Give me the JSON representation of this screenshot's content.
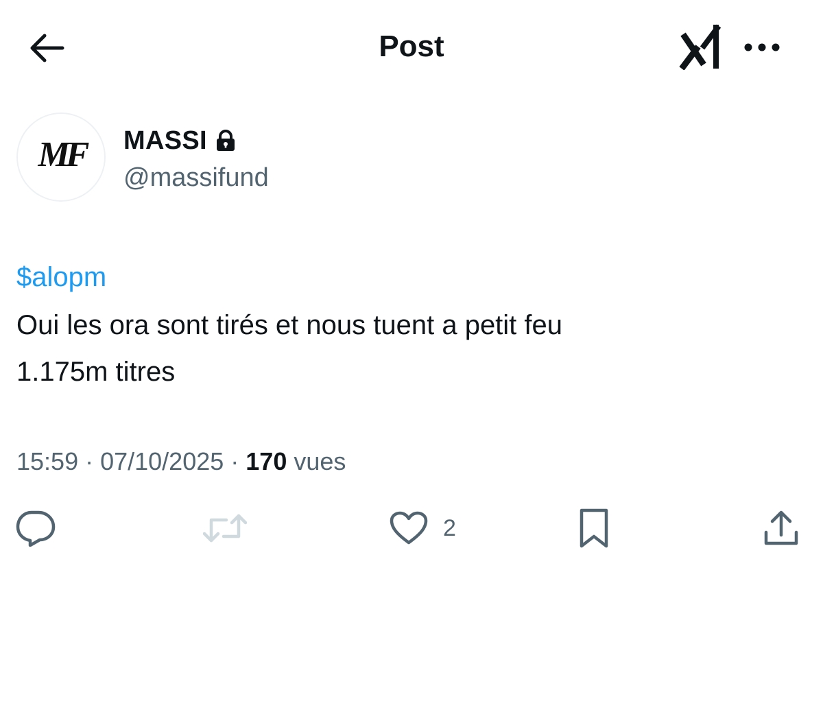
{
  "header": {
    "title": "Post",
    "back_icon": "back-arrow-icon",
    "grok_icon": "grok-icon",
    "more_icon": "more-icon"
  },
  "author": {
    "display_name": "MASSI",
    "handle": "@massifund",
    "avatar_initials": "MF",
    "protected_icon": "lock-icon"
  },
  "post": {
    "cashtag": "$alopm",
    "lines": [
      "Oui les ora sont tirés et nous tuent a petit feu",
      "1.175m titres"
    ]
  },
  "meta": {
    "time": "15:59",
    "separator": " · ",
    "date": "07/10/2025",
    "views_count": "170",
    "views_label": "vues"
  },
  "actions": {
    "reply_icon": "reply-icon",
    "retweet_icon": "retweet-icon",
    "like_icon": "heart-icon",
    "like_count": "2",
    "bookmark_icon": "bookmark-icon",
    "share_icon": "share-icon"
  },
  "colors": {
    "text": "#0f1419",
    "secondary": "#536471",
    "link": "#1d9bf0",
    "disabled": "#cfd9de"
  }
}
